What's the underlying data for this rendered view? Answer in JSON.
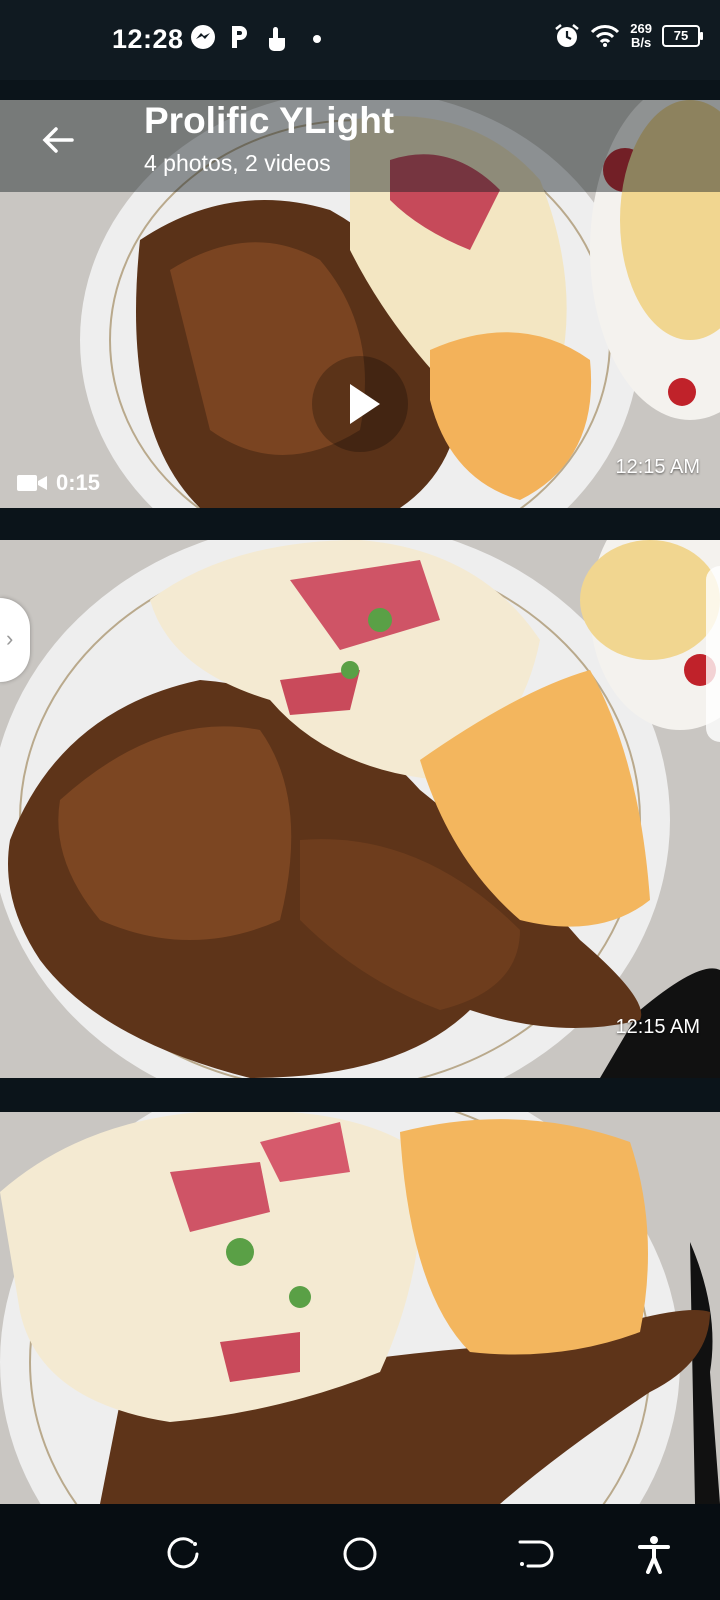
{
  "status_bar": {
    "time": "12:28",
    "net_speed_value": "269",
    "net_speed_unit": "B/s",
    "battery": "75",
    "icons": [
      "messenger-icon",
      "p-icon",
      "touch-icon",
      "dot-icon",
      "alarm-icon",
      "wifi-icon",
      "battery-icon"
    ]
  },
  "header": {
    "title": "Prolific YLight",
    "subtitle": "4 photos, 2 videos"
  },
  "media": [
    {
      "type": "video",
      "duration": "0:15",
      "time": "12:15 AM"
    },
    {
      "type": "photo",
      "time": "12:15 AM"
    },
    {
      "type": "photo",
      "time": ""
    }
  ],
  "nav": {
    "icons": [
      "recents-icon",
      "home-icon",
      "back-icon",
      "accessibility-icon"
    ]
  }
}
